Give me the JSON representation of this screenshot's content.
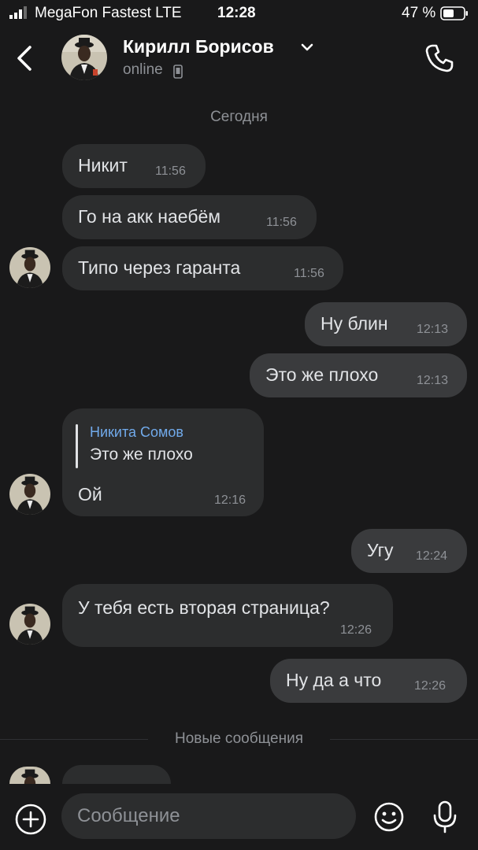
{
  "status_bar": {
    "carrier": "MegaFon Fastest  LTE",
    "time": "12:28",
    "battery": "47 %"
  },
  "header": {
    "name": "Кирилл Борисов",
    "presence": "online"
  },
  "date_divider": "Сегодня",
  "messages": [
    {
      "text": "Никит",
      "time": "11:56"
    },
    {
      "text": "Го на акк наебём",
      "time": "11:56"
    },
    {
      "text": "Типо через гаранта",
      "time": "11:56"
    },
    {
      "text": "Ну блин",
      "time": "12:13"
    },
    {
      "text": "Это же плохо",
      "time": "12:13"
    },
    {
      "reply_author": "Никита Сомов",
      "reply_text": "Это же плохо",
      "text": "Ой",
      "time": "12:16"
    },
    {
      "text": "Угу",
      "time": "12:24"
    },
    {
      "text": "У тебя есть вторая страница?",
      "time": "12:26"
    },
    {
      "text": "Ну да а что",
      "time": "12:26"
    }
  ],
  "new_messages_divider": "Новые сообщения",
  "composer": {
    "placeholder": "Сообщение"
  },
  "colors": {
    "background": "#19191a",
    "bubble_incoming": "#2c2d2e",
    "bubble_outgoing": "#3a3b3d",
    "reply_author": "#71aaeb",
    "muted": "#8e9196"
  },
  "icons": [
    "signal-icon",
    "battery-icon",
    "back-icon",
    "chevron-down-icon",
    "phone-icon",
    "add-icon",
    "emoji-icon",
    "microphone-icon"
  ]
}
